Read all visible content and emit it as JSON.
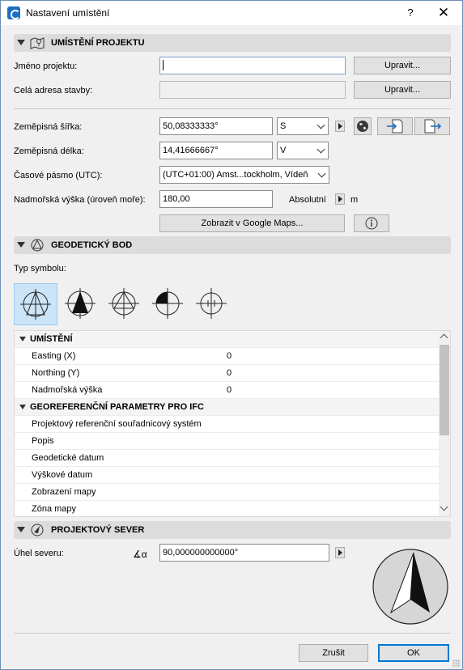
{
  "window": {
    "title": "Nastavení umístění",
    "help_label": "?",
    "close_label": "✕"
  },
  "project_location": {
    "section_title": "UMÍSTĚNÍ PROJEKTU",
    "project_name": {
      "label": "Jméno projektu:",
      "value": "",
      "button": "Upravit..."
    },
    "full_address": {
      "label": "Celá adresa stavby:",
      "value": "",
      "button": "Upravit..."
    },
    "latitude": {
      "label": "Zeměpisná šířka:",
      "value": "50,08333333°",
      "direction": "S"
    },
    "longitude": {
      "label": "Zeměpisná délka:",
      "value": "14,41666667°",
      "direction": "V"
    },
    "timezone": {
      "label": "Časové pásmo (UTC):",
      "value": "(UTC+01:00) Amst...tockholm, Vídeň"
    },
    "altitude": {
      "label": "Nadmořská výška (úroveň moře):",
      "value": "180,00",
      "mode": "Absolutní",
      "unit": "m"
    },
    "google_maps_button": "Zobrazit v Google Maps...",
    "icons": [
      "map-pin-icon",
      "globe-icon",
      "import-file-icon",
      "export-file-icon",
      "info-icon"
    ]
  },
  "survey_point": {
    "section_title": "GEODETICKÝ BOD",
    "symbol_type_label": "Typ symbolu:",
    "selected_symbol_index": 0,
    "properties": {
      "group_location": "UMÍSTĚNÍ",
      "rows_location": [
        {
          "name": "Easting (X)",
          "value": "0"
        },
        {
          "name": "Northing (Y)",
          "value": "0"
        },
        {
          "name": "Nadmořská výška",
          "value": "0"
        }
      ],
      "group_ifc": "GEOREFERENČNÍ PARAMETRY PRO IFC",
      "rows_ifc": [
        {
          "name": "Projektový referenční souřadnicový systém",
          "value": ""
        },
        {
          "name": "Popis",
          "value": ""
        },
        {
          "name": "Geodetické datum",
          "value": ""
        },
        {
          "name": "Výškové datum",
          "value": ""
        },
        {
          "name": "Zobrazení mapy",
          "value": ""
        },
        {
          "name": "Zóna mapy",
          "value": ""
        }
      ]
    }
  },
  "project_north": {
    "section_title": "PROJEKTOVÝ SEVER",
    "angle_label": "Úhel severu:",
    "angle_value": "90,000000000000°",
    "angle_symbol": "∡α"
  },
  "footer": {
    "cancel_label": "Zrušit",
    "ok_label": "OK"
  }
}
